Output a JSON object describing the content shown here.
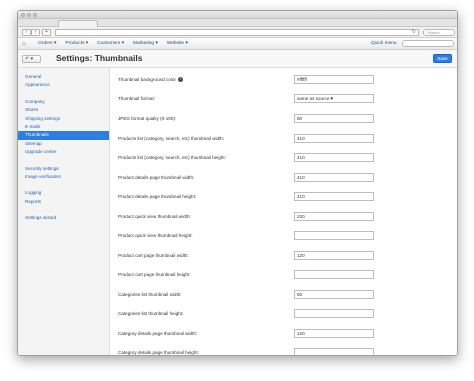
{
  "browser": {
    "reload_icon": "reload-icon",
    "search_placeholder": "Search"
  },
  "nav": {
    "home_icon": "home-icon",
    "items": [
      "Orders ▾",
      "Products ▾",
      "Customers ▾",
      "Marketing ▾",
      "Website ▾"
    ],
    "quick_menu": "Quick menu"
  },
  "header": {
    "back_icon": "back-arrow-icon",
    "title": "Settings: Thumbnails",
    "save_label": "Save"
  },
  "sidebar": {
    "items": [
      {
        "label": "General"
      },
      {
        "label": "Appearance"
      },
      {
        "label": "Company"
      },
      {
        "label": "Stores"
      },
      {
        "label": "Shipping settings"
      },
      {
        "label": "E-mails"
      },
      {
        "label": "Thumbnails"
      },
      {
        "label": "Sitemap"
      },
      {
        "label": "Upgrade center"
      },
      {
        "label": "Security settings"
      },
      {
        "label": "Image verification"
      },
      {
        "label": "Logging"
      },
      {
        "label": "Reports"
      },
      {
        "label": "Settings wizard"
      }
    ],
    "active": "Thumbnails"
  },
  "form": {
    "fields": [
      {
        "label": "Thumbnail background color",
        "value": "#ffffff"
      },
      {
        "label": "Thumbnail format:",
        "value": "same as source"
      },
      {
        "label": "JPEG format quality (0-100):",
        "value": "80"
      },
      {
        "label": "Products list (category, search, etc) thumbnail width:",
        "value": "410"
      },
      {
        "label": "Products list (category, search, etc) thumbnail height:",
        "value": "410"
      },
      {
        "label": "Product details page thumbnail width:",
        "value": "410"
      },
      {
        "label": "Product details page thumbnail height:",
        "value": "410"
      },
      {
        "label": "Product quick view thumbnail width:",
        "value": "220"
      },
      {
        "label": "Product quick view thumbnail height:",
        "value": ""
      },
      {
        "label": "Product cart page thumbnail width:",
        "value": "120"
      },
      {
        "label": "Product cart page thumbnail height:",
        "value": ""
      },
      {
        "label": "Categories list thumbnail width:",
        "value": "60"
      },
      {
        "label": "Categories list thumbnail height:",
        "value": ""
      },
      {
        "label": "Category details page thumbnail width:",
        "value": "120"
      },
      {
        "label": "Category details page thumbnail height:",
        "value": ""
      }
    ]
  }
}
